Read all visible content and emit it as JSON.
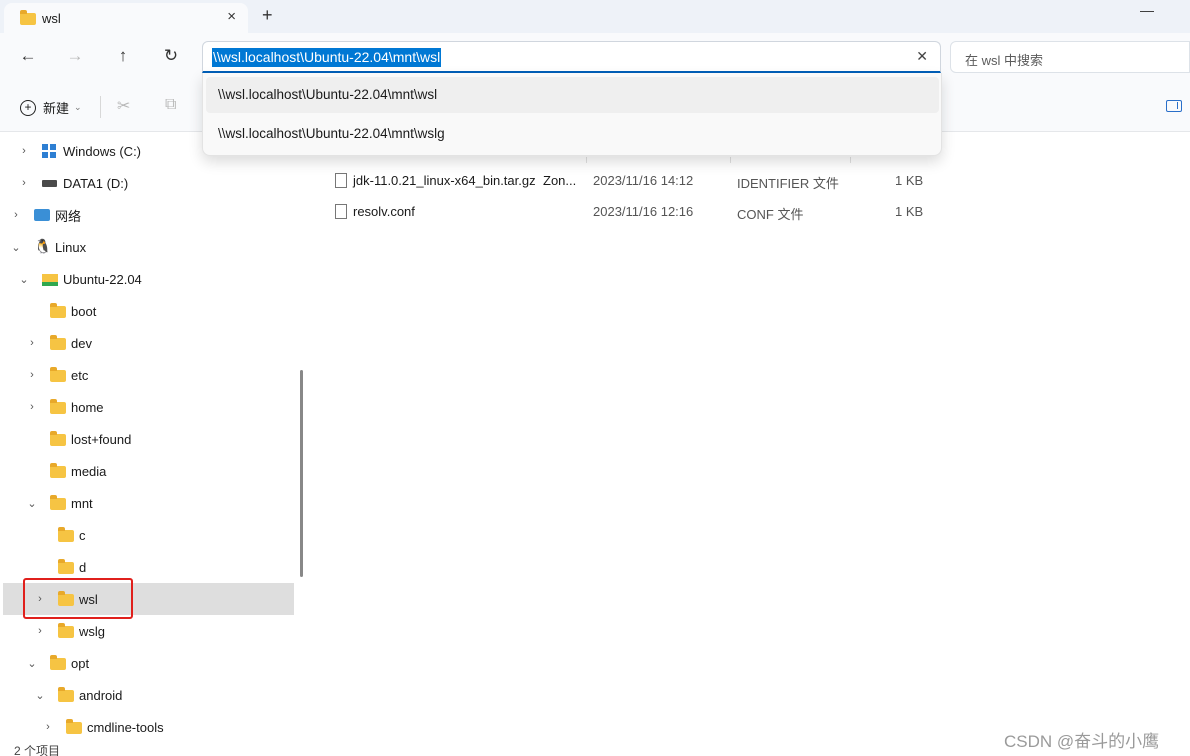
{
  "tab": {
    "title": "wsl",
    "close_icon": "×",
    "new_tab_icon": "+"
  },
  "window": {
    "minimize_icon": "—"
  },
  "nav": {
    "back_icon": "←",
    "forward_icon": "→",
    "up_icon": "↑",
    "refresh_icon": "↻",
    "address": "\\\\wsl.localhost\\Ubuntu-22.04\\mnt\\wsl",
    "clear_icon": "✕",
    "search_placeholder": "在 wsl 中搜索"
  },
  "toolbar": {
    "new_label": "新建",
    "new_caret": "⌄",
    "cut_icon": "✂",
    "copy_icon": "⧉"
  },
  "suggestions": [
    "\\\\wsl.localhost\\Ubuntu-22.04\\mnt\\wsl",
    "\\\\wsl.localhost\\Ubuntu-22.04\\mnt\\wslg"
  ],
  "sidebar": {
    "items": [
      {
        "label": "Windows (C:)",
        "icon": "windows-drive-icon"
      },
      {
        "label": "DATA1 (D:)",
        "icon": "drive-icon"
      },
      {
        "label": "网络",
        "icon": "network-icon"
      },
      {
        "label": "Linux",
        "icon": "tux-icon"
      },
      {
        "label": "Ubuntu-22.04",
        "icon": "ubuntu-folder-icon"
      },
      {
        "label": "boot",
        "icon": "folder-icon"
      },
      {
        "label": "dev",
        "icon": "folder-icon"
      },
      {
        "label": "etc",
        "icon": "folder-icon"
      },
      {
        "label": "home",
        "icon": "folder-icon"
      },
      {
        "label": "lost+found",
        "icon": "folder-icon"
      },
      {
        "label": "media",
        "icon": "folder-icon"
      },
      {
        "label": "mnt",
        "icon": "folder-icon"
      },
      {
        "label": "c",
        "icon": "folder-icon"
      },
      {
        "label": "d",
        "icon": "folder-icon"
      },
      {
        "label": "wsl",
        "icon": "folder-icon",
        "selected": true
      },
      {
        "label": "wslg",
        "icon": "folder-icon"
      },
      {
        "label": "opt",
        "icon": "folder-icon"
      },
      {
        "label": "android",
        "icon": "folder-icon"
      },
      {
        "label": "cmdline-tools",
        "icon": "folder-icon"
      }
    ],
    "chevron_right": "›",
    "chevron_down": "⌄"
  },
  "files": [
    {
      "name": "jdk-11.0.21_linux-x64_bin.tar.gz",
      "extra": "Zon...",
      "date": "2023/11/16 14:12",
      "type": "IDENTIFIER 文件",
      "size": "1 KB"
    },
    {
      "name": "resolv.conf",
      "extra": "",
      "date": "2023/11/16 12:16",
      "type": "CONF 文件",
      "size": "1 KB"
    }
  ],
  "status": {
    "item_count": "2 个项目"
  },
  "watermark": "CSDN @奋斗的小鹰",
  "colors": {
    "accent": "#0078d4",
    "highlight_border": "#e0201c",
    "selected_row": "#dedede"
  }
}
